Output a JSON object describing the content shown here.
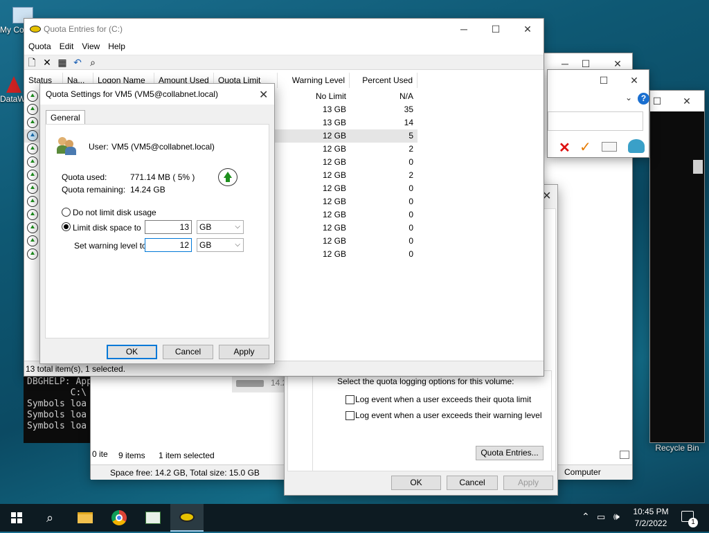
{
  "desktop": {
    "icons": [
      {
        "label": "My Co",
        "icon": "computer-icon"
      },
      {
        "label": "DataW",
        "icon": "datawedge-icon"
      },
      {
        "label": "Recycle Bin",
        "icon": "recycle-bin-icon"
      }
    ]
  },
  "quota_window": {
    "title": "Quota Entries for  (C:)",
    "menu": [
      "Quota",
      "Edit",
      "View",
      "Help"
    ],
    "columns": [
      "Status",
      "Na...",
      "Logon Name",
      "Amount Used",
      "Quota Limit",
      "Warning Level",
      "Percent Used"
    ],
    "rows": [
      {
        "warning": "No Limit",
        "percent": "N/A",
        "selected": false,
        "status": "ok"
      },
      {
        "warning": "13 GB",
        "percent": "35",
        "selected": false,
        "status": "ok"
      },
      {
        "warning": "13 GB",
        "percent": "14",
        "selected": false,
        "status": "ok"
      },
      {
        "warning": "12 GB",
        "percent": "5",
        "selected": true,
        "status": "info"
      },
      {
        "warning": "12 GB",
        "percent": "2",
        "selected": false,
        "status": "ok"
      },
      {
        "warning": "12 GB",
        "percent": "0",
        "selected": false,
        "status": "ok"
      },
      {
        "warning": "12 GB",
        "percent": "2",
        "selected": false,
        "status": "ok"
      },
      {
        "warning": "12 GB",
        "percent": "0",
        "selected": false,
        "status": "ok"
      },
      {
        "warning": "12 GB",
        "percent": "0",
        "selected": false,
        "status": "ok"
      },
      {
        "warning": "12 GB",
        "percent": "0",
        "selected": false,
        "status": "ok"
      },
      {
        "warning": "12 GB",
        "percent": "0",
        "selected": false,
        "status": "ok"
      },
      {
        "warning": "12 GB",
        "percent": "0",
        "selected": false,
        "status": "ok"
      },
      {
        "warning": "12 GB",
        "percent": "0",
        "selected": false,
        "status": "ok"
      }
    ],
    "status": "13 total item(s), 1 selected."
  },
  "dialog": {
    "title": "Quota Settings for VM5 (VM5@collabnet.local)",
    "tab": "General",
    "user_label": "User:",
    "user_value": "VM5 (VM5@collabnet.local)",
    "quota_used_label": "Quota used:",
    "quota_used_value": "771.14 MB ( 5% )",
    "quota_remaining_label": "Quota remaining:",
    "quota_remaining_value": "14.24 GB",
    "no_limit_label": "Do not limit disk usage",
    "limit_label": "Limit disk space to",
    "limit_value": "13",
    "limit_unit": "GB",
    "warning_label": "Set warning level to",
    "warning_value": "12",
    "warning_unit": "GB",
    "ok": "OK",
    "cancel": "Cancel",
    "apply": "Apply"
  },
  "explorer": {
    "size_label": "14.2",
    "items": "9 items",
    "selected": "1 item selected",
    "space": "Space free: 14.2 GB, Total size: 15.0 GB",
    "zero_items": "0 ite",
    "zero_i": "0 i",
    "computer": "Computer"
  },
  "props": {
    "logging_text": "Select the quota logging options for this volume:",
    "log_limit": "Log event when a user exceeds their quota limit",
    "log_warning": "Log event when a user exceeds their warning level",
    "quota_entries": "Quota Entries...",
    "ok": "OK",
    "cancel": "Cancel",
    "apply": "Apply"
  },
  "console": {
    "lines": [
      "DBGHELP: App",
      "        C:\\",
      "Symbols loa",
      "Symbols loa",
      "Symbols loa"
    ]
  },
  "taskbar": {
    "time": "10:45 PM",
    "date": "7/2/2022",
    "notif_count": "1"
  }
}
